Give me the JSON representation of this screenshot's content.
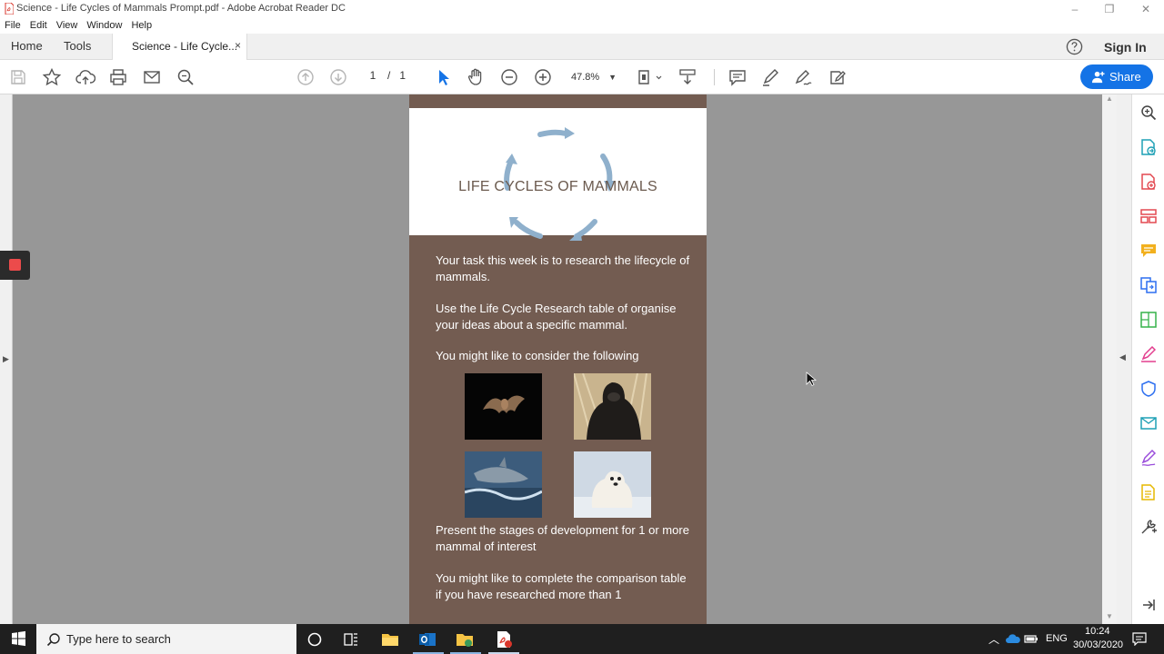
{
  "window": {
    "title": "Science - Life Cycles of Mammals Prompt.pdf - Adobe Acrobat Reader DC",
    "minimize": "–",
    "maximize": "❐",
    "close": "✕"
  },
  "menubar": {
    "items": [
      "File",
      "Edit",
      "View",
      "Window",
      "Help"
    ]
  },
  "tabs": {
    "home": "Home",
    "tools": "Tools",
    "document": "Science - Life Cycle...",
    "document_close": "×",
    "signin": "Sign In"
  },
  "toolbar": {
    "page_current": "1",
    "page_total": "/   1",
    "zoom": "47.8%",
    "share": "Share"
  },
  "document": {
    "title": "LIFE CYCLES OF MAMMALS",
    "paragraphs": [
      "Your task this week is to research the lifecycle of mammals.",
      "Use the Life Cycle Research table of organise your ideas about a specific mammal.",
      "You might like to consider the following",
      "Present the stages of development for 1 or more mammal of interest",
      "You might like to complete the comparison table if you have researched more than 1"
    ],
    "images": [
      "bat-photo",
      "gorilla-photo",
      "dolphin-photo",
      "polar-bear-photo"
    ]
  },
  "taskbar": {
    "search_placeholder": "Type here to search",
    "language": "ENG",
    "time": "10:24",
    "date": "30/03/2020"
  },
  "colors": {
    "accent": "#1473e6",
    "page_brown": "#735c51",
    "title_text": "#6b5a4e",
    "cycle_arrow": "#8fb0cc"
  }
}
